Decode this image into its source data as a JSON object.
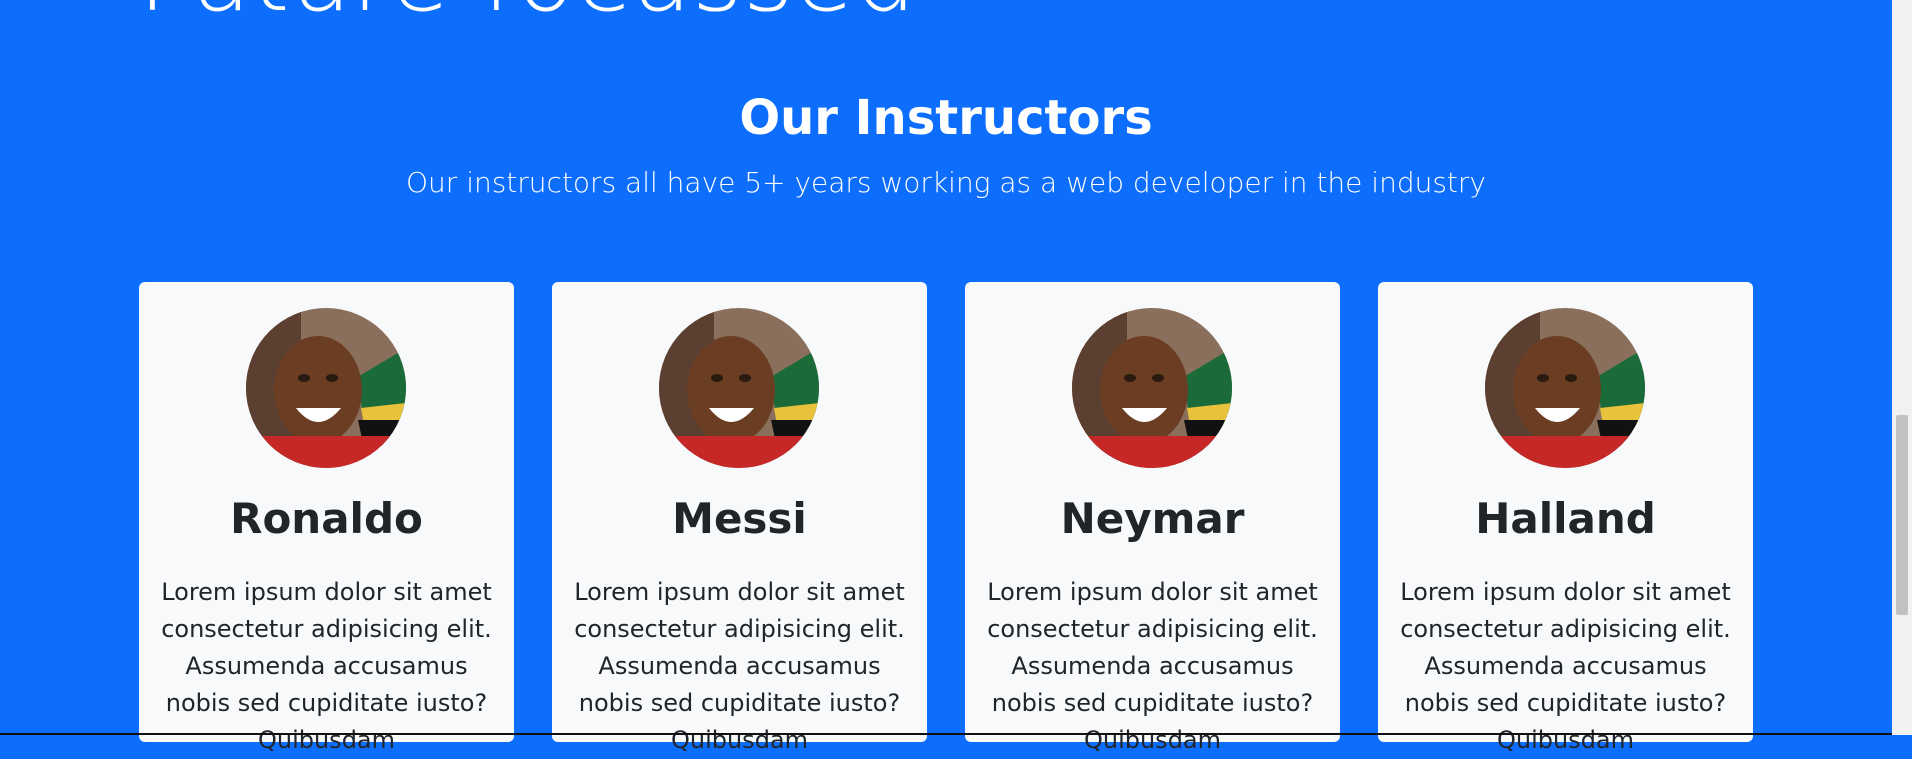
{
  "hero": {
    "title": "Future focussed"
  },
  "instructors": {
    "heading": "Our Instructors",
    "subheading": "Our instructors all have 5+ years working as a web developer in the industry",
    "cards": [
      {
        "name": "Ronaldo",
        "text": "Lorem ipsum dolor sit amet consectetur adipisicing elit. Assumenda accusamus nobis sed cupiditate iusto? Quibusdam"
      },
      {
        "name": "Messi",
        "text": "Lorem ipsum dolor sit amet consectetur adipisicing elit. Assumenda accusamus nobis sed cupiditate iusto? Quibusdam"
      },
      {
        "name": "Neymar",
        "text": "Lorem ipsum dolor sit amet consectetur adipisicing elit. Assumenda accusamus nobis sed cupiditate iusto? Quibusdam"
      },
      {
        "name": "Halland",
        "text": "Lorem ipsum dolor sit amet consectetur adipisicing elit. Assumenda accusamus nobis sed cupiditate iusto? Quibusdam"
      }
    ]
  },
  "colors": {
    "background": "#0d6efd",
    "card": "#f8f9fa",
    "text": "#212529"
  }
}
